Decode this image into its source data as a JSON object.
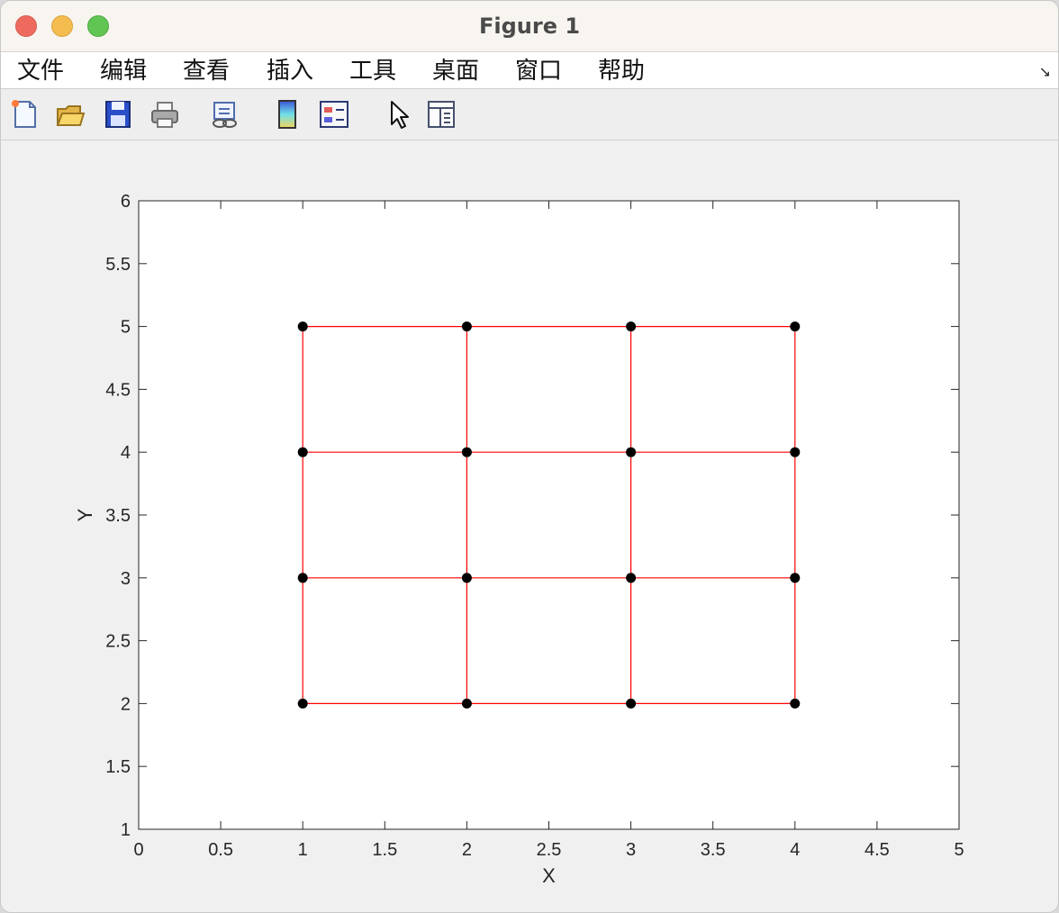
{
  "window": {
    "title": "Figure 1"
  },
  "menu": {
    "items": [
      "文件",
      "编辑",
      "查看",
      "插入",
      "工具",
      "桌面",
      "窗口",
      "帮助"
    ],
    "end_glyph": "↘"
  },
  "toolbar": {
    "icons": [
      "new-figure-icon",
      "open-file-icon",
      "save-icon",
      "print-icon",
      "link-plot-icon",
      "colorbar-icon",
      "legend-icon",
      "pointer-icon",
      "property-inspector-icon"
    ]
  },
  "chart_data": {
    "type": "line",
    "xlabel": "X",
    "ylabel": "Y",
    "xlim": [
      0,
      5
    ],
    "ylim": [
      1,
      6
    ],
    "xticks": [
      0,
      0.5,
      1,
      1.5,
      2,
      2.5,
      3,
      3.5,
      4,
      4.5,
      5
    ],
    "yticks": [
      1,
      1.5,
      2,
      2.5,
      3,
      3.5,
      4,
      4.5,
      5,
      5.5,
      6
    ],
    "xtick_labels": [
      "0",
      "0.5",
      "1",
      "1.5",
      "2",
      "2.5",
      "3",
      "3.5",
      "4",
      "4.5",
      "5"
    ],
    "ytick_labels": [
      "1",
      "1.5",
      "2",
      "2.5",
      "3",
      "3.5",
      "4",
      "4.5",
      "5",
      "5.5",
      "6"
    ],
    "grid": false,
    "grid_x": [
      1,
      2,
      3,
      4
    ],
    "grid_y": [
      2,
      3,
      4,
      5
    ],
    "line_color": "#ff0000",
    "marker_color": "#000000"
  }
}
